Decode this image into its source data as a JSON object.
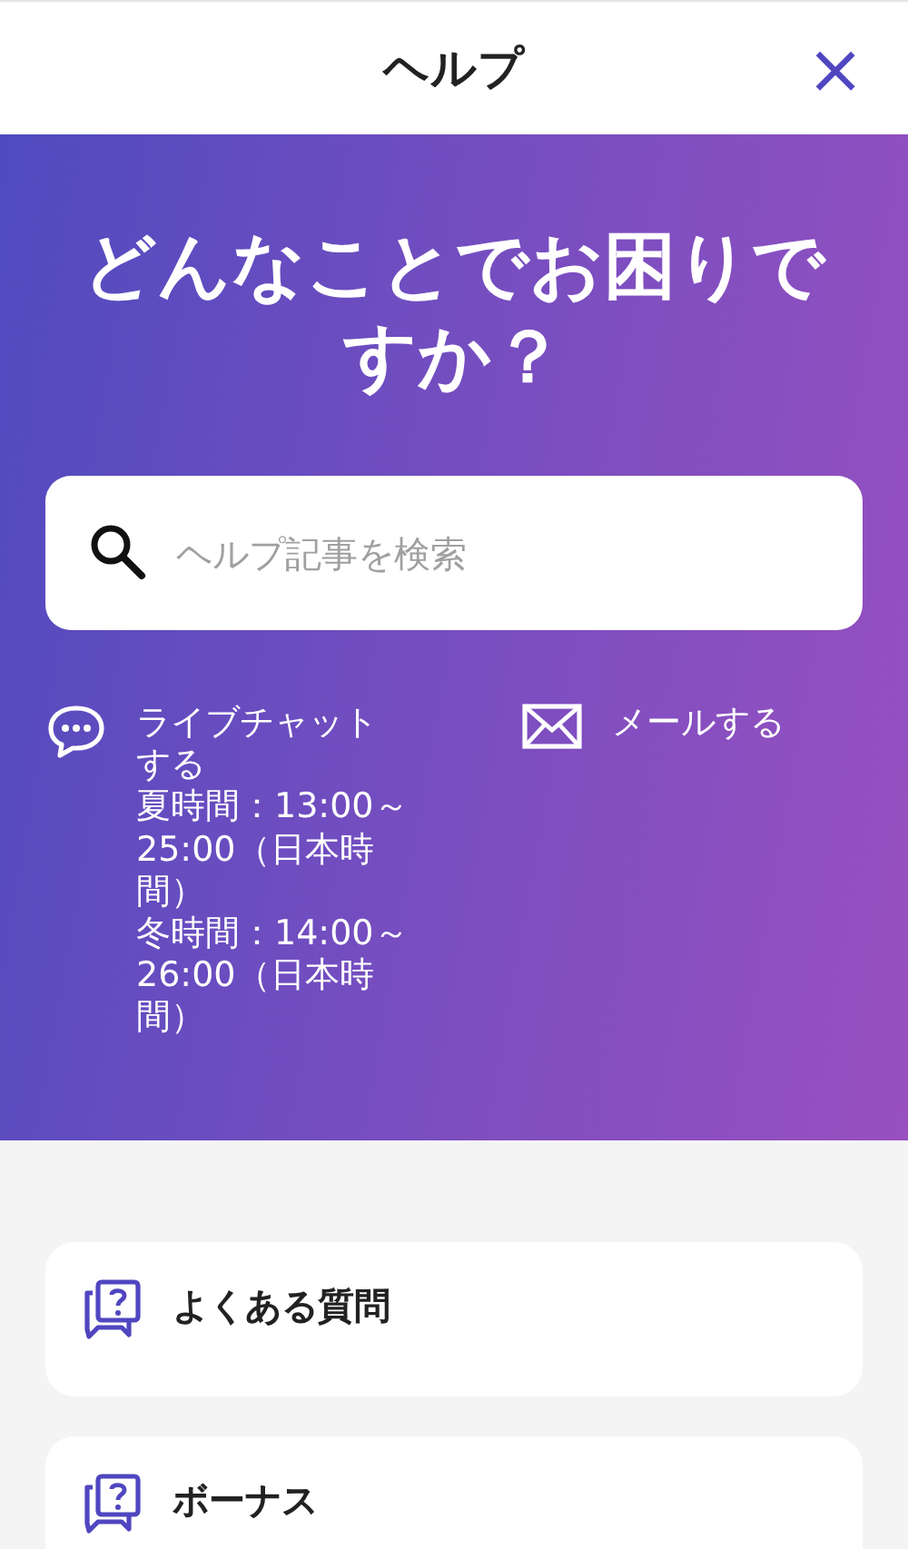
{
  "header": {
    "title": "ヘルプ",
    "close": "×"
  },
  "hero": {
    "heading": "どんなことでお困りですか？",
    "search": {
      "placeholder": "ヘルプ記事を検索"
    },
    "contacts": [
      {
        "kind": "chat",
        "label": "ライブチャットする",
        "hours": [
          "夏時間：13:00～25:00（日本時間）",
          "冬時間：14:00～26:00（日本時間）"
        ]
      },
      {
        "kind": "mail",
        "label": "メールする"
      }
    ]
  },
  "categories": [
    {
      "label": "よくある質問"
    },
    {
      "label": "ボーナス"
    }
  ]
}
